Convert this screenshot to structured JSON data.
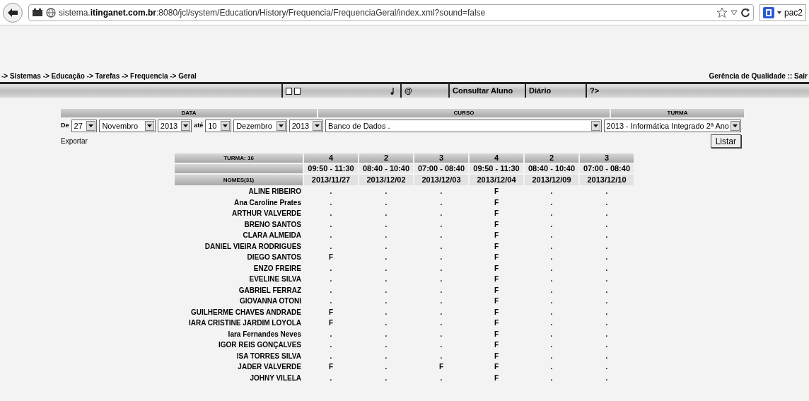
{
  "browser": {
    "url_host": "sistema.",
    "url_domain": "itinganet.com.br",
    "url_rest": ":8080/jcl/system/Education/History/Frequencia/FrequenciaGeral/index.xml?sound=false",
    "search_engine": "pac2"
  },
  "breadcrumb": "-> Sistemas -> Educação -> Tarefas -> Frequencia -> Geral",
  "user_links": "Gerência de Qualidade :: Sair",
  "nav": [
    {
      "label": "@"
    },
    {
      "label": "Consultar Aluno"
    },
    {
      "label": "Diário"
    },
    {
      "label": "?>"
    }
  ],
  "filters": {
    "headers": [
      "DATA",
      "CURSO",
      "TURMA"
    ],
    "from_label": "De",
    "until_label": "até",
    "from_day": "27",
    "from_month": "Novembro",
    "from_year": "2013",
    "to_day": "10",
    "to_month": "Dezembro",
    "to_year": "2013",
    "course": "Banco de Dados .",
    "class": "2013 - Informática Integrado 2ª Ano"
  },
  "export_link": "Exportar",
  "list_button": "Listar",
  "table": {
    "class_label": "TURMA: 16",
    "names_label": "NOMES(31)",
    "columns": [
      {
        "count": "4",
        "time": "09:50 - 11:30",
        "date": "2013/11/27"
      },
      {
        "count": "2",
        "time": "08:40 - 10:40",
        "date": "2013/12/02"
      },
      {
        "count": "3",
        "time": "07:00 - 08:40",
        "date": "2013/12/03"
      },
      {
        "count": "4",
        "time": "09:50 - 11:30",
        "date": "2013/12/04"
      },
      {
        "count": "2",
        "time": "08:40 - 10:40",
        "date": "2013/12/09"
      },
      {
        "count": "3",
        "time": "07:00 - 08:40",
        "date": "2013/12/10"
      }
    ],
    "rows": [
      {
        "name": "ALINE RIBEIRO",
        "marks": [
          ".",
          ".",
          ".",
          "F",
          ".",
          "."
        ]
      },
      {
        "name": "Ana Caroline Prates",
        "marks": [
          ".",
          ".",
          ".",
          "F",
          ".",
          "."
        ]
      },
      {
        "name": "ARTHUR VALVERDE",
        "marks": [
          ".",
          ".",
          ".",
          "F",
          ".",
          "."
        ]
      },
      {
        "name": "BRENO SANTOS",
        "marks": [
          ".",
          ".",
          ".",
          "F",
          ".",
          "."
        ]
      },
      {
        "name": "CLARA ALMEIDA",
        "marks": [
          ".",
          ".",
          ".",
          "F",
          ".",
          "."
        ]
      },
      {
        "name": "DANIEL VIEIRA RODRIGUES",
        "marks": [
          ".",
          ".",
          ".",
          "F",
          ".",
          "."
        ]
      },
      {
        "name": "DIEGO SANTOS",
        "marks": [
          "F",
          ".",
          ".",
          "F",
          ".",
          "."
        ]
      },
      {
        "name": "ENZO FREIRE",
        "marks": [
          ".",
          ".",
          ".",
          "F",
          ".",
          "."
        ]
      },
      {
        "name": "EVELINE SILVA",
        "marks": [
          ".",
          ".",
          ".",
          "F",
          ".",
          "."
        ]
      },
      {
        "name": "GABRIEL FERRAZ",
        "marks": [
          ".",
          ".",
          ".",
          "F",
          ".",
          "."
        ]
      },
      {
        "name": "GIOVANNA OTONI",
        "marks": [
          ".",
          ".",
          ".",
          "F",
          ".",
          "."
        ]
      },
      {
        "name": "GUILHERME CHAVES ANDRADE",
        "marks": [
          "F",
          ".",
          ".",
          "F",
          ".",
          "."
        ]
      },
      {
        "name": "IARA CRISTINE JARDIM LOYOLA",
        "marks": [
          "F",
          ".",
          ".",
          "F",
          ".",
          "."
        ]
      },
      {
        "name": "Iara Fernandes Neves",
        "marks": [
          ".",
          ".",
          ".",
          "F",
          ".",
          "."
        ]
      },
      {
        "name": "IGOR REIS GONÇALVES",
        "marks": [
          ".",
          ".",
          ".",
          "F",
          ".",
          "."
        ]
      },
      {
        "name": "ISA TORRES SILVA",
        "marks": [
          ".",
          ".",
          ".",
          "F",
          ".",
          "."
        ]
      },
      {
        "name": "JADER VALVERDE",
        "marks": [
          "F",
          ".",
          "F",
          "F",
          ".",
          "."
        ]
      },
      {
        "name": "JOHNY VILELA",
        "marks": [
          ".",
          ".",
          ".",
          "F",
          ".",
          "."
        ]
      }
    ]
  }
}
